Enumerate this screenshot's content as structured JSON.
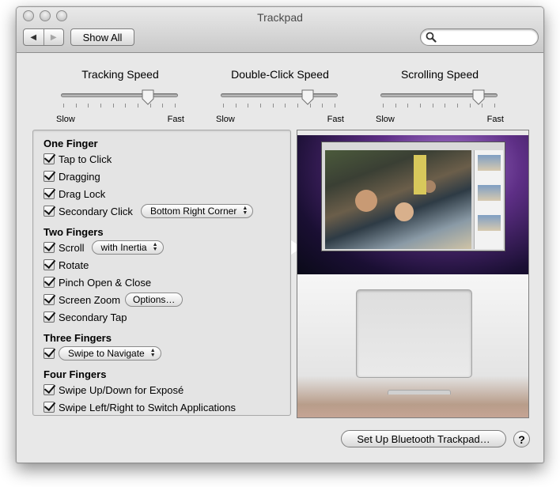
{
  "window": {
    "title": "Trackpad"
  },
  "toolbar": {
    "back_icon": "back-arrow-icon",
    "forward_icon": "forward-arrow-icon",
    "show_all_label": "Show All",
    "search_placeholder": "",
    "search_icon": "magnifier-icon"
  },
  "sliders": [
    {
      "title": "Tracking Speed",
      "min_label": "Slow",
      "max_label": "Fast",
      "level": 0.75,
      "ticks": 10
    },
    {
      "title": "Double-Click Speed",
      "min_label": "Slow",
      "max_label": "Fast",
      "level": 0.75,
      "ticks": 10
    },
    {
      "title": "Scrolling Speed",
      "min_label": "Slow",
      "max_label": "Fast",
      "level": 0.85,
      "ticks": 10
    }
  ],
  "sections": {
    "one_finger": {
      "title": "One Finger",
      "tap_to_click": {
        "label": "Tap to Click",
        "checked": true
      },
      "dragging": {
        "label": "Dragging",
        "checked": true
      },
      "drag_lock": {
        "label": "Drag Lock",
        "checked": true
      },
      "secondary_click": {
        "label": "Secondary Click",
        "checked": true,
        "popup_value": "Bottom Right Corner"
      }
    },
    "two_fingers": {
      "title": "Two Fingers",
      "scroll": {
        "label": "Scroll",
        "checked": true,
        "popup_value": "with Inertia",
        "selected": true
      },
      "rotate": {
        "label": "Rotate",
        "checked": true
      },
      "pinch": {
        "label": "Pinch Open & Close",
        "checked": true
      },
      "screen_zoom": {
        "label": "Screen Zoom",
        "checked": true,
        "button_label": "Options…"
      },
      "secondary_tap": {
        "label": "Secondary Tap",
        "checked": true
      }
    },
    "three_fingers": {
      "title": "Three Fingers",
      "swipe": {
        "checked": true,
        "popup_value": "Swipe to Navigate"
      }
    },
    "four_fingers": {
      "title": "Four Fingers",
      "swipe_up_down": {
        "label": "Swipe Up/Down for Exposé",
        "checked": true
      },
      "swipe_left_right": {
        "label": "Swipe Left/Right to Switch Applications",
        "checked": true
      }
    }
  },
  "footer": {
    "bluetooth_label": "Set Up Bluetooth Trackpad…",
    "help_label": "?"
  },
  "colors": {
    "window_bg": "#e8e8e8",
    "panel_bg": "#e4e4e4",
    "preview_desktop": "#5e2f86"
  }
}
